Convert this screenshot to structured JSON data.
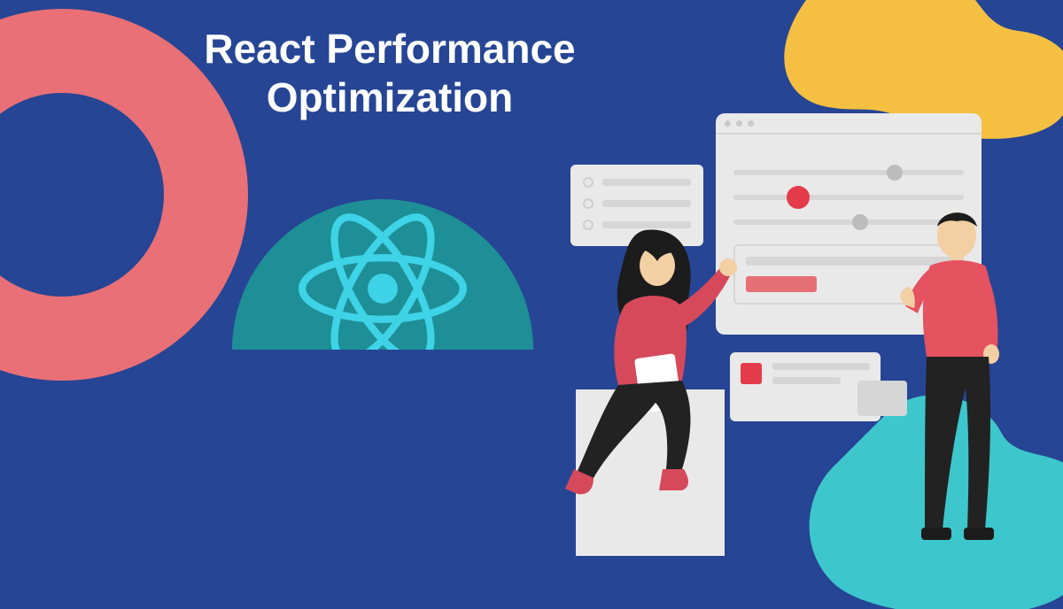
{
  "title_line1": "React Performance",
  "title_line2": "Optimization",
  "colors": {
    "background": "#264594",
    "pink": "#E97076",
    "yellow": "#F5C041",
    "teal": "#1E8E97",
    "aqua": "#3DC7CC",
    "react": "#3ED3E6",
    "red": "#E43B4A",
    "skin": "#F2D0A4",
    "dark": "#222222"
  }
}
